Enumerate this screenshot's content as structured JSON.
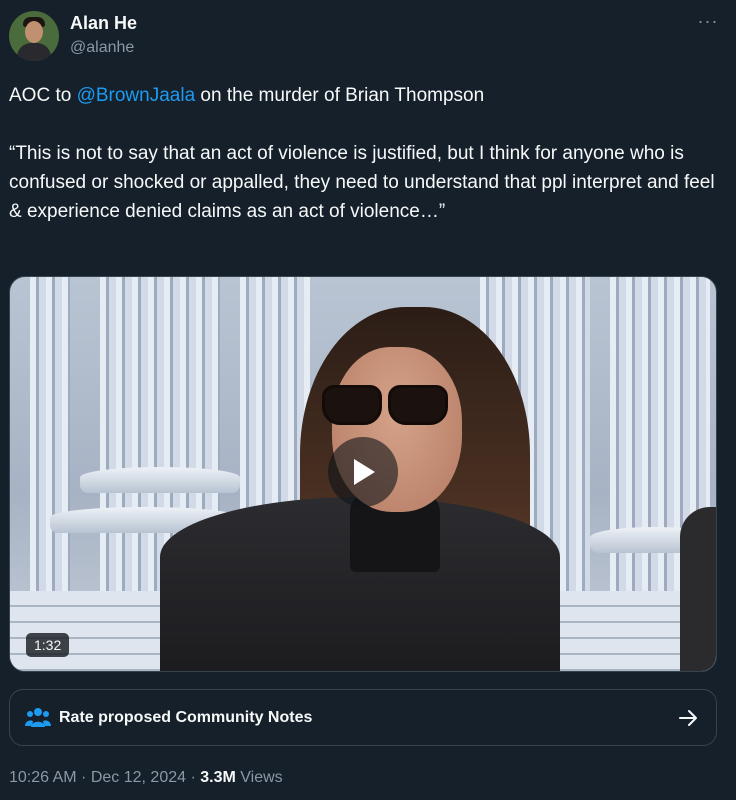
{
  "author": {
    "display_name": "Alan He",
    "handle": "@alanhe"
  },
  "tweet": {
    "line1_prefix": "AOC to ",
    "mention": "@BrownJaala",
    "line1_suffix": " on the murder of Brian Thompson",
    "quote": "“This is not to say that an act of violence is justified, but I think for anyone who is confused or shocked or appalled, they need to understand that ppl interpret and feel & experience denied claims as an act of violence…”"
  },
  "video": {
    "duration": "1:32"
  },
  "community_notes": {
    "label": "Rate proposed Community Notes",
    "icon": "people-icon"
  },
  "meta": {
    "time": "10:26 AM",
    "separator": " · ",
    "date": "Dec 12, 2024",
    "views_count": "3.3M",
    "views_label": " Views"
  },
  "colors": {
    "background": "#15202b",
    "text": "#f7f9f9",
    "secondary": "#8b98a5",
    "accent": "#1d9bf0",
    "border": "#38444d"
  }
}
